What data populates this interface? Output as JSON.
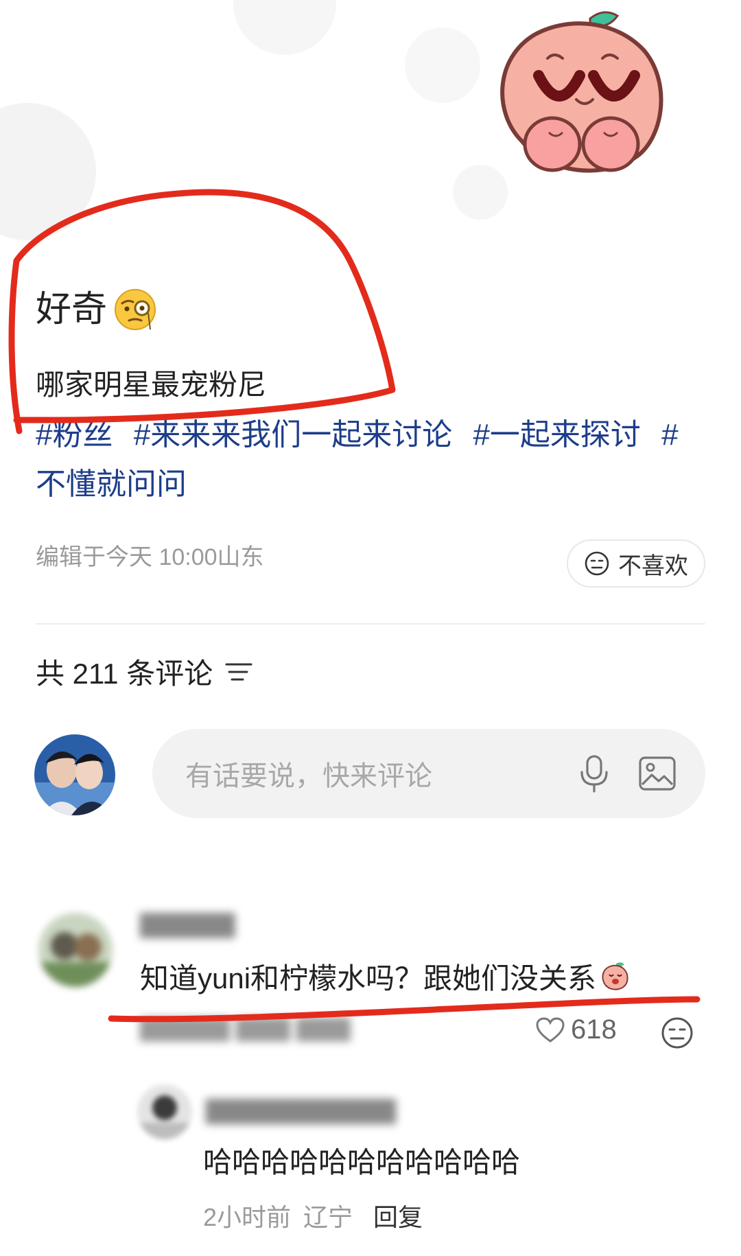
{
  "post": {
    "title": "好奇",
    "body": "哪家明星最宠粉尼",
    "hashtags": [
      "#粉丝",
      "#来来来我们一起来讨论",
      "#一起来探讨",
      "#不懂就问问"
    ],
    "meta": "编辑于今天 10:00山东",
    "dislike_label": "不喜欢"
  },
  "comments_section": {
    "header": "共 211 条评论",
    "input_placeholder": "有话要说，快来评论",
    "icons": {
      "mic": "mic-icon",
      "image": "image-icon",
      "sort": "sort-icon"
    }
  },
  "comment": {
    "text": "知道yuni和柠檬水吗？跟她们没关系",
    "likes": "618"
  },
  "reply": {
    "text": "哈哈哈哈哈哈哈哈哈哈哈",
    "time": "2小时前",
    "location": "辽宁",
    "reply_label": "回复"
  },
  "colors": {
    "hashtag": "#1d3d8a",
    "annotation": "#e32b1c",
    "mascot": "#f6b1a4"
  }
}
